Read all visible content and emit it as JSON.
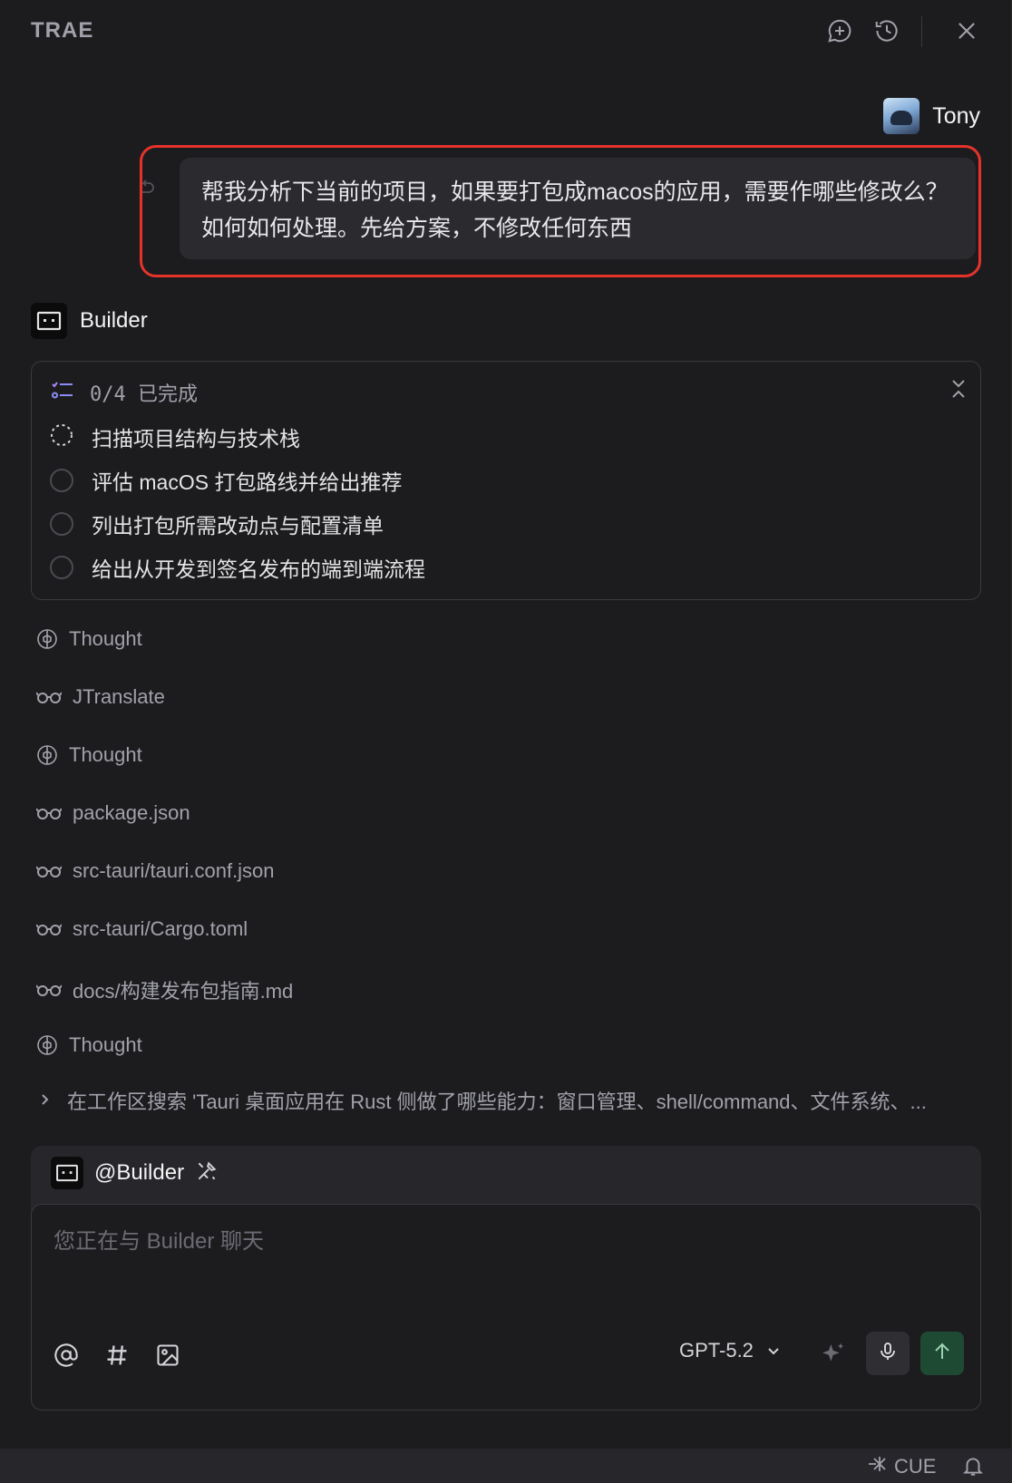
{
  "app": {
    "title": "TRAE"
  },
  "header": {
    "new_chat_icon": "chat-plus-icon",
    "history_icon": "history-icon",
    "close_icon": "close-icon"
  },
  "user": {
    "name": "Tony"
  },
  "message": {
    "text": "帮我分析下当前的项目，如果要打包成macos的应用，需要作哪些修改么？如何如何处理。先给方案，不修改任何东西"
  },
  "agent": {
    "name": "Builder"
  },
  "todo": {
    "progress": "0/4 已完成",
    "items": [
      {
        "label": "扫描项目结构与技术栈",
        "status": "in-progress"
      },
      {
        "label": "评估 macOS 打包路线并给出推荐",
        "status": "pending"
      },
      {
        "label": "列出打包所需改动点与配置清单",
        "status": "pending"
      },
      {
        "label": "给出从开发到签名发布的端到端流程",
        "status": "pending"
      }
    ]
  },
  "activity": [
    {
      "type": "thought",
      "label": "Thought",
      "icon": "brain-icon"
    },
    {
      "type": "read",
      "label": "JTranslate",
      "icon": "glasses-icon"
    },
    {
      "type": "thought",
      "label": "Thought",
      "icon": "brain-icon"
    },
    {
      "type": "read",
      "label": "package.json",
      "icon": "glasses-icon"
    },
    {
      "type": "read",
      "label": "src-tauri/tauri.conf.json",
      "icon": "glasses-icon"
    },
    {
      "type": "read",
      "label": "src-tauri/Cargo.toml",
      "icon": "glasses-icon"
    },
    {
      "type": "read",
      "label": "docs/构建发布包指南.md",
      "icon": "glasses-icon"
    },
    {
      "type": "thought",
      "label": "Thought",
      "icon": "brain-icon"
    }
  ],
  "search": {
    "text": "在工作区搜索 'Tauri 桌面应用在 Rust 侧做了哪些能力：窗口管理、shell/command、文件系统、..."
  },
  "composer": {
    "mention": "@Builder",
    "placeholder": "您正在与 Builder 聊天",
    "model": "GPT-5.2"
  },
  "statusbar": {
    "cue": "CUE"
  },
  "colors": {
    "highlight": "#e5332a",
    "send_button": "#1e4a34",
    "background": "#1c1c1f"
  }
}
